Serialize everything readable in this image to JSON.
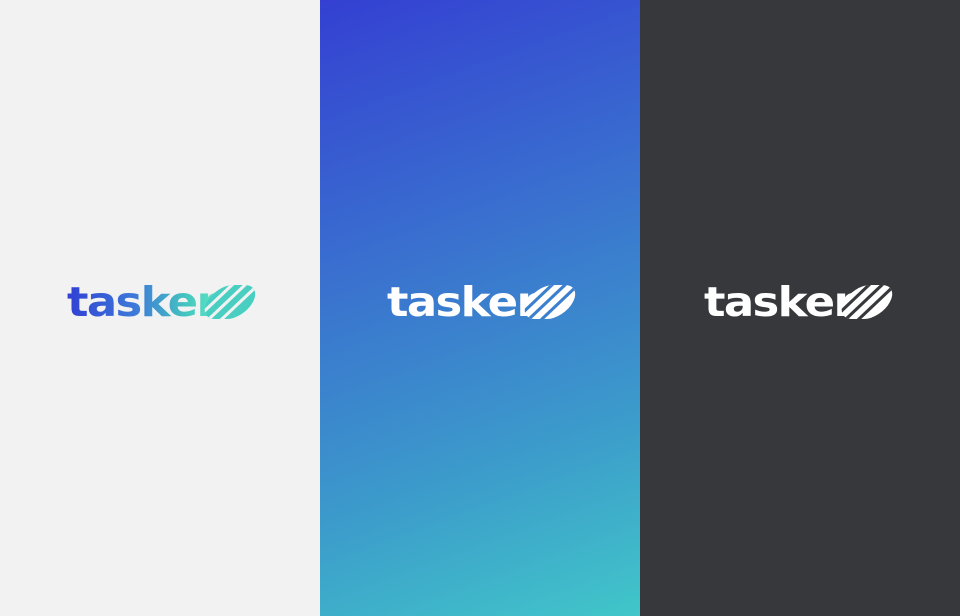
{
  "brand": {
    "wordmark": "tasker",
    "mark_icon": "diagonal-stripes-mark-icon"
  },
  "variants": [
    {
      "name": "light",
      "background": "#f2f2f2",
      "logo_style": "gradient",
      "gradient_colors": [
        "#3140d4",
        "#3d7ad8",
        "#45c9be",
        "#5fe8c6"
      ]
    },
    {
      "name": "gradient",
      "background_gradient": [
        "#3440d2",
        "#41c6c9"
      ],
      "logo_color": "#ffffff"
    },
    {
      "name": "dark",
      "background": "#36383b",
      "logo_color": "#ffffff"
    }
  ]
}
